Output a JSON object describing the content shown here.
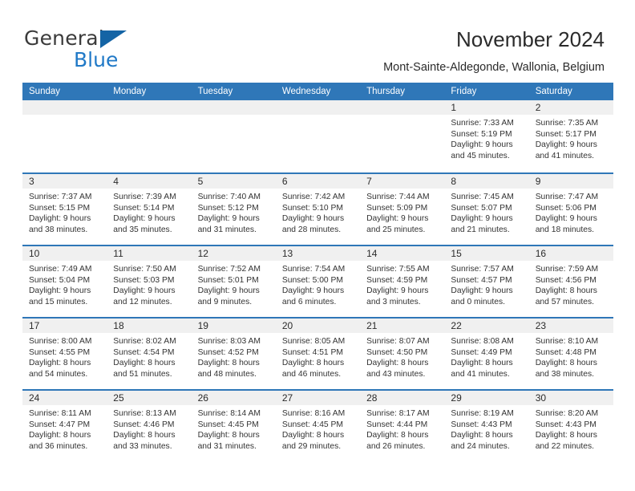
{
  "brand": {
    "name_top": "General",
    "name_bottom": "Blue",
    "accent_color": "#1464a5",
    "blue_text_color": "#2079c7"
  },
  "header": {
    "title": "November 2024",
    "subtitle": "Mont-Sainte-Aldegonde, Wallonia, Belgium"
  },
  "theme": {
    "header_blue": "#2f77b8",
    "daynum_band": "#f0f0f0",
    "text": "#2b2b2b"
  },
  "calendar": {
    "weekdays": [
      "Sunday",
      "Monday",
      "Tuesday",
      "Wednesday",
      "Thursday",
      "Friday",
      "Saturday"
    ],
    "weeks": [
      [
        {
          "day": "",
          "empty": true
        },
        {
          "day": "",
          "empty": true
        },
        {
          "day": "",
          "empty": true
        },
        {
          "day": "",
          "empty": true
        },
        {
          "day": "",
          "empty": true
        },
        {
          "day": "1",
          "sunrise": "Sunrise: 7:33 AM",
          "sunset": "Sunset: 5:19 PM",
          "daylight1": "Daylight: 9 hours",
          "daylight2": "and 45 minutes."
        },
        {
          "day": "2",
          "sunrise": "Sunrise: 7:35 AM",
          "sunset": "Sunset: 5:17 PM",
          "daylight1": "Daylight: 9 hours",
          "daylight2": "and 41 minutes."
        }
      ],
      [
        {
          "day": "3",
          "sunrise": "Sunrise: 7:37 AM",
          "sunset": "Sunset: 5:15 PM",
          "daylight1": "Daylight: 9 hours",
          "daylight2": "and 38 minutes."
        },
        {
          "day": "4",
          "sunrise": "Sunrise: 7:39 AM",
          "sunset": "Sunset: 5:14 PM",
          "daylight1": "Daylight: 9 hours",
          "daylight2": "and 35 minutes."
        },
        {
          "day": "5",
          "sunrise": "Sunrise: 7:40 AM",
          "sunset": "Sunset: 5:12 PM",
          "daylight1": "Daylight: 9 hours",
          "daylight2": "and 31 minutes."
        },
        {
          "day": "6",
          "sunrise": "Sunrise: 7:42 AM",
          "sunset": "Sunset: 5:10 PM",
          "daylight1": "Daylight: 9 hours",
          "daylight2": "and 28 minutes."
        },
        {
          "day": "7",
          "sunrise": "Sunrise: 7:44 AM",
          "sunset": "Sunset: 5:09 PM",
          "daylight1": "Daylight: 9 hours",
          "daylight2": "and 25 minutes."
        },
        {
          "day": "8",
          "sunrise": "Sunrise: 7:45 AM",
          "sunset": "Sunset: 5:07 PM",
          "daylight1": "Daylight: 9 hours",
          "daylight2": "and 21 minutes."
        },
        {
          "day": "9",
          "sunrise": "Sunrise: 7:47 AM",
          "sunset": "Sunset: 5:06 PM",
          "daylight1": "Daylight: 9 hours",
          "daylight2": "and 18 minutes."
        }
      ],
      [
        {
          "day": "10",
          "sunrise": "Sunrise: 7:49 AM",
          "sunset": "Sunset: 5:04 PM",
          "daylight1": "Daylight: 9 hours",
          "daylight2": "and 15 minutes."
        },
        {
          "day": "11",
          "sunrise": "Sunrise: 7:50 AM",
          "sunset": "Sunset: 5:03 PM",
          "daylight1": "Daylight: 9 hours",
          "daylight2": "and 12 minutes."
        },
        {
          "day": "12",
          "sunrise": "Sunrise: 7:52 AM",
          "sunset": "Sunset: 5:01 PM",
          "daylight1": "Daylight: 9 hours",
          "daylight2": "and 9 minutes."
        },
        {
          "day": "13",
          "sunrise": "Sunrise: 7:54 AM",
          "sunset": "Sunset: 5:00 PM",
          "daylight1": "Daylight: 9 hours",
          "daylight2": "and 6 minutes."
        },
        {
          "day": "14",
          "sunrise": "Sunrise: 7:55 AM",
          "sunset": "Sunset: 4:59 PM",
          "daylight1": "Daylight: 9 hours",
          "daylight2": "and 3 minutes."
        },
        {
          "day": "15",
          "sunrise": "Sunrise: 7:57 AM",
          "sunset": "Sunset: 4:57 PM",
          "daylight1": "Daylight: 9 hours",
          "daylight2": "and 0 minutes."
        },
        {
          "day": "16",
          "sunrise": "Sunrise: 7:59 AM",
          "sunset": "Sunset: 4:56 PM",
          "daylight1": "Daylight: 8 hours",
          "daylight2": "and 57 minutes."
        }
      ],
      [
        {
          "day": "17",
          "sunrise": "Sunrise: 8:00 AM",
          "sunset": "Sunset: 4:55 PM",
          "daylight1": "Daylight: 8 hours",
          "daylight2": "and 54 minutes."
        },
        {
          "day": "18",
          "sunrise": "Sunrise: 8:02 AM",
          "sunset": "Sunset: 4:54 PM",
          "daylight1": "Daylight: 8 hours",
          "daylight2": "and 51 minutes."
        },
        {
          "day": "19",
          "sunrise": "Sunrise: 8:03 AM",
          "sunset": "Sunset: 4:52 PM",
          "daylight1": "Daylight: 8 hours",
          "daylight2": "and 48 minutes."
        },
        {
          "day": "20",
          "sunrise": "Sunrise: 8:05 AM",
          "sunset": "Sunset: 4:51 PM",
          "daylight1": "Daylight: 8 hours",
          "daylight2": "and 46 minutes."
        },
        {
          "day": "21",
          "sunrise": "Sunrise: 8:07 AM",
          "sunset": "Sunset: 4:50 PM",
          "daylight1": "Daylight: 8 hours",
          "daylight2": "and 43 minutes."
        },
        {
          "day": "22",
          "sunrise": "Sunrise: 8:08 AM",
          "sunset": "Sunset: 4:49 PM",
          "daylight1": "Daylight: 8 hours",
          "daylight2": "and 41 minutes."
        },
        {
          "day": "23",
          "sunrise": "Sunrise: 8:10 AM",
          "sunset": "Sunset: 4:48 PM",
          "daylight1": "Daylight: 8 hours",
          "daylight2": "and 38 minutes."
        }
      ],
      [
        {
          "day": "24",
          "sunrise": "Sunrise: 8:11 AM",
          "sunset": "Sunset: 4:47 PM",
          "daylight1": "Daylight: 8 hours",
          "daylight2": "and 36 minutes."
        },
        {
          "day": "25",
          "sunrise": "Sunrise: 8:13 AM",
          "sunset": "Sunset: 4:46 PM",
          "daylight1": "Daylight: 8 hours",
          "daylight2": "and 33 minutes."
        },
        {
          "day": "26",
          "sunrise": "Sunrise: 8:14 AM",
          "sunset": "Sunset: 4:45 PM",
          "daylight1": "Daylight: 8 hours",
          "daylight2": "and 31 minutes."
        },
        {
          "day": "27",
          "sunrise": "Sunrise: 8:16 AM",
          "sunset": "Sunset: 4:45 PM",
          "daylight1": "Daylight: 8 hours",
          "daylight2": "and 29 minutes."
        },
        {
          "day": "28",
          "sunrise": "Sunrise: 8:17 AM",
          "sunset": "Sunset: 4:44 PM",
          "daylight1": "Daylight: 8 hours",
          "daylight2": "and 26 minutes."
        },
        {
          "day": "29",
          "sunrise": "Sunrise: 8:19 AM",
          "sunset": "Sunset: 4:43 PM",
          "daylight1": "Daylight: 8 hours",
          "daylight2": "and 24 minutes."
        },
        {
          "day": "30",
          "sunrise": "Sunrise: 8:20 AM",
          "sunset": "Sunset: 4:43 PM",
          "daylight1": "Daylight: 8 hours",
          "daylight2": "and 22 minutes."
        }
      ]
    ]
  }
}
